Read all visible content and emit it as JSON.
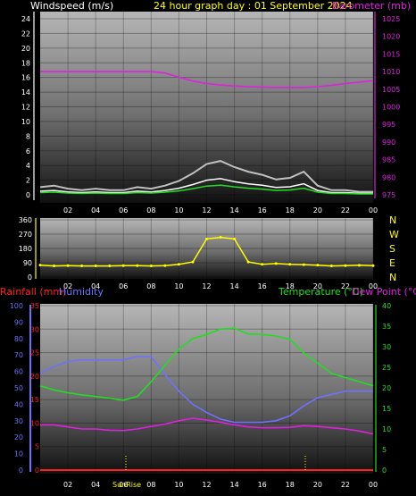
{
  "header": {
    "left_title": "Windspeed (m/s)",
    "center_title": "24 hour graph day : 01 September 2024",
    "right_title": "Barometer (mb)"
  },
  "colors": {
    "windspeed": "#ffffff",
    "windgust": "#c0c0c0",
    "wind_avg": "#22dd22",
    "barometer": "#dd22dd",
    "wind_direction": "#ffff00",
    "rainfall": "#ff2020",
    "humidity": "#7070ff",
    "temperature": "#22dd22",
    "dew_point": "#dd22dd",
    "sunrise_marker": "#ffff00"
  },
  "panel1": {
    "left_ticks": [
      "24",
      "22",
      "20",
      "18",
      "16",
      "14",
      "12",
      "10",
      "8",
      "6",
      "4",
      "2",
      "0"
    ],
    "right_ticks": [
      "1025",
      "1020",
      "1015",
      "1010",
      "1005",
      "1000",
      "995",
      "990",
      "985",
      "980",
      "975"
    ],
    "x_ticks": [
      "02",
      "04",
      "06",
      "08",
      "10",
      "12",
      "14",
      "16",
      "18",
      "20",
      "22",
      "00"
    ]
  },
  "panel2": {
    "left_ticks": [
      "360",
      "270",
      "180",
      "90",
      "0"
    ],
    "compass": [
      "N",
      "W",
      "S",
      "E",
      "N"
    ],
    "x_ticks": [
      "02",
      "04",
      "06",
      "08",
      "10",
      "12",
      "14",
      "16",
      "18",
      "20",
      "22",
      "00"
    ]
  },
  "panel3": {
    "label_rain": "Rainfall (mm)",
    "label_humidity": "Humidity",
    "label_temperature": "Temperature (°C)",
    "label_dewpoint": "Dew Point (°C)",
    "humidity_ticks": [
      "100",
      "90",
      "80",
      "70",
      "60",
      "50",
      "40",
      "30",
      "20",
      "10",
      "0"
    ],
    "rain_ticks": [
      "35",
      "30",
      "25",
      "20",
      "15",
      "10",
      "5",
      "0"
    ],
    "temp_ticks": [
      "40",
      "35",
      "30",
      "25",
      "20",
      "15",
      "10",
      "5",
      "0"
    ],
    "x_ticks": [
      "02",
      "04",
      "06",
      "08",
      "10",
      "12",
      "14",
      "16",
      "18",
      "20",
      "22",
      "00"
    ],
    "sunrise_label": "SunRise"
  },
  "chart_data": [
    {
      "type": "line",
      "ylim_left": [
        0,
        24
      ],
      "ylim_right": [
        975,
        1025
      ],
      "x": [
        0,
        1,
        2,
        3,
        4,
        5,
        6,
        7,
        8,
        9,
        10,
        11,
        12,
        13,
        14,
        15,
        16,
        17,
        18,
        19,
        20,
        21,
        22,
        23,
        24
      ],
      "series": [
        {
          "name": "Windspeed (m/s)",
          "axis": "left",
          "values": [
            0.5,
            0.6,
            0.4,
            0.3,
            0.4,
            0.3,
            0.3,
            0.5,
            0.4,
            0.6,
            0.9,
            1.4,
            2.0,
            2.2,
            1.8,
            1.5,
            1.3,
            1.0,
            1.1,
            1.5,
            0.6,
            0.3,
            0.3,
            0.2,
            0.2
          ]
        },
        {
          "name": "Barometer (mb)",
          "axis": "right",
          "values": [
            1010,
            1010,
            1010,
            1010,
            1010,
            1010,
            1010,
            1010,
            1010,
            1009.6,
            1008.4,
            1007.3,
            1006.6,
            1006.2,
            1005.9,
            1005.7,
            1005.6,
            1005.5,
            1005.5,
            1005.5,
            1005.7,
            1006.1,
            1006.6,
            1007.0,
            1007.4
          ]
        }
      ]
    },
    {
      "type": "scatter",
      "ylim": [
        0,
        360
      ],
      "x": [
        0,
        1,
        2,
        3,
        4,
        5,
        6,
        7,
        8,
        9,
        10,
        11,
        12,
        13,
        14,
        15,
        16,
        17,
        18,
        19,
        20,
        21,
        22,
        23,
        24
      ],
      "series": [
        {
          "name": "Wind direction",
          "values": [
            75,
            70,
            72,
            70,
            70,
            70,
            72,
            72,
            70,
            72,
            80,
            95,
            240,
            250,
            240,
            95,
            80,
            85,
            80,
            78,
            75,
            70,
            72,
            74,
            72
          ]
        }
      ]
    },
    {
      "type": "line",
      "ylim_humidity": [
        0,
        100
      ],
      "ylim_rain": [
        0,
        35
      ],
      "ylim_temp": [
        0,
        40
      ],
      "x": [
        0,
        1,
        2,
        3,
        4,
        5,
        6,
        7,
        8,
        9,
        10,
        11,
        12,
        13,
        14,
        15,
        16,
        17,
        18,
        19,
        20,
        21,
        22,
        23,
        24
      ],
      "series": [
        {
          "name": "Rainfall (mm)",
          "axis": "rain",
          "values": [
            0,
            0,
            0,
            0,
            0,
            0,
            0,
            0,
            0,
            0,
            0,
            0,
            0,
            0,
            0,
            0,
            0,
            0,
            0,
            0,
            0,
            0,
            0,
            0,
            0
          ]
        },
        {
          "name": "Humidity",
          "axis": "humidity",
          "values": [
            59,
            63,
            66,
            67,
            67,
            67,
            67,
            69,
            69,
            58,
            48,
            40,
            35,
            31,
            29,
            29,
            29,
            30,
            33,
            39,
            44,
            46,
            48,
            48,
            48
          ]
        },
        {
          "name": "Temperature (°C)",
          "axis": "temp",
          "values": [
            20.5,
            19.5,
            18.8,
            18.3,
            17.9,
            17.5,
            17.0,
            17.9,
            21.5,
            25.5,
            29.5,
            32.0,
            33.0,
            34.3,
            34.5,
            33.1,
            33.0,
            32.6,
            31.8,
            28.5,
            26.0,
            23.5,
            22.5,
            21.5,
            20.5
          ]
        },
        {
          "name": "Dew Point (°C)",
          "axis": "temp",
          "values": [
            11,
            11,
            10.5,
            10,
            10,
            9.7,
            9.6,
            10,
            10.6,
            11.2,
            12,
            12.6,
            12.2,
            11.6,
            11,
            10.5,
            10.3,
            10.3,
            10.4,
            10.8,
            10.6,
            10.3,
            10,
            9.5,
            8.8
          ]
        }
      ]
    }
  ]
}
